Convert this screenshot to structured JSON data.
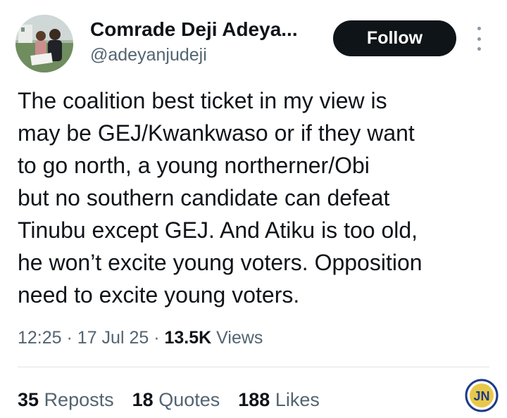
{
  "author": {
    "display_name": "Comrade Deji Adeya...",
    "handle": "@adeyanjudeji"
  },
  "actions": {
    "follow_label": "Follow",
    "more_icon": "more-vertical-icon"
  },
  "tweet": {
    "lines": [
      "The coalition best ticket in my view is",
      "may be GEJ/Kwankwaso or if they want",
      "to go north, a young northerner/Obi",
      "but no southern candidate can defeat",
      "Tinubu except GEJ. And Atiku is too old,",
      "he won’t excite young voters. Opposition",
      "need to excite young voters."
    ]
  },
  "meta": {
    "time": "12:25",
    "separator": "·",
    "date": "17 Jul 25",
    "views_count": "13.5K",
    "views_label": "Views"
  },
  "stats": {
    "reposts_count": "35",
    "reposts_label": "Reposts",
    "quotes_count": "18",
    "quotes_label": "Quotes",
    "likes_count": "188",
    "likes_label": "Likes"
  },
  "watermark": {
    "text": "JN",
    "color": "#1d3a8a"
  },
  "colors": {
    "text_primary": "#0f1419",
    "text_secondary": "#536471",
    "button_bg": "#0f1419",
    "divider": "#dfe3e7"
  }
}
